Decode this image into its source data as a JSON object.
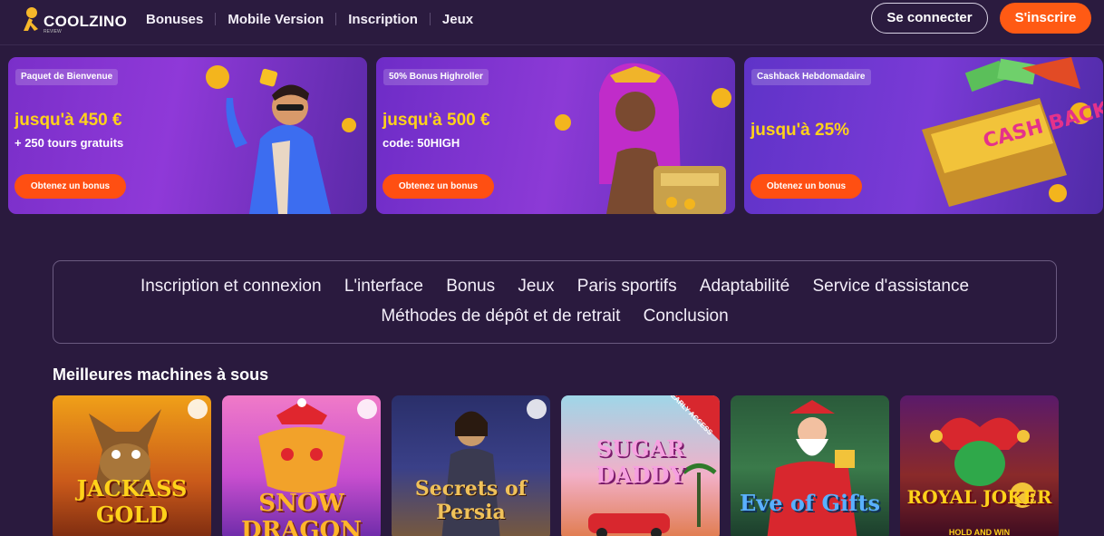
{
  "header": {
    "logo_text": "COOLZINO",
    "logo_tagline": "REVIEW",
    "nav": [
      "Bonuses",
      "Mobile Version",
      "Inscription",
      "Jeux"
    ],
    "login_label": "Se connecter",
    "signup_label": "S'inscrire"
  },
  "bonus_cards": [
    {
      "chip": "Paquet de Bienvenue",
      "amount": "jusqu'à 450 €",
      "sub": "+ 250 tours gratuits",
      "cta": "Obtenez un bonus"
    },
    {
      "chip": "50% Bonus Highroller",
      "amount": "jusqu'à 500 €",
      "sub": "code: 50HIGH",
      "cta": "Obtenez un bonus"
    },
    {
      "chip": "Cashback Hebdomadaire",
      "amount": "jusqu'à 25%",
      "sub": "",
      "cta": "Obtenez un bonus",
      "art_text": "CASH BACK"
    }
  ],
  "toc": {
    "row1": [
      "Inscription et connexion",
      "L'interface",
      "Bonus",
      "Jeux",
      "Paris sportifs",
      "Adaptabilité",
      "Service d'assistance"
    ],
    "row2": [
      "Méthodes de dépôt et de retrait",
      "Conclusion"
    ]
  },
  "slots": {
    "title": "Meilleures machines à sous",
    "items": [
      {
        "name": "JACKASS GOLD"
      },
      {
        "name": "SNOW DRAGON"
      },
      {
        "name": "Secrets of Persia"
      },
      {
        "name": "SUGAR DADDY",
        "ribbon": "EARLY ACCESS"
      },
      {
        "name": "Eve of Gifts"
      },
      {
        "name": "ROYAL JOKER",
        "sub": "HOLD AND WIN"
      }
    ]
  },
  "colors": {
    "background": "#2a1a3e",
    "accent": "#ff5a14",
    "amount": "#ffd21a"
  }
}
